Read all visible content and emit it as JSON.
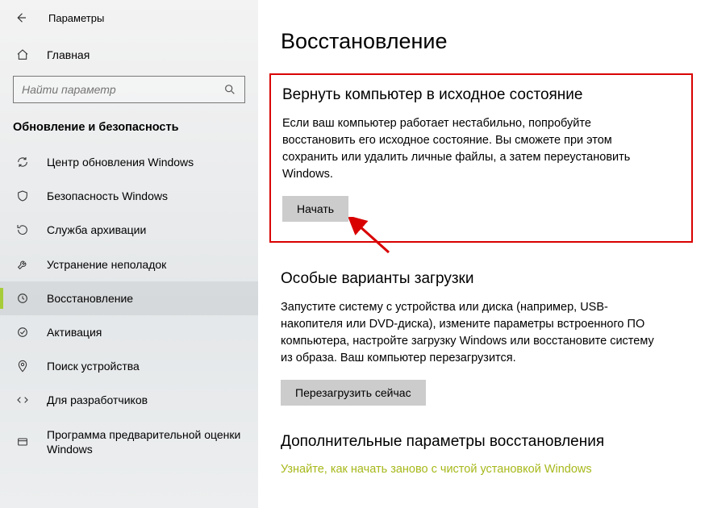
{
  "window": {
    "title": "Параметры"
  },
  "sidebar": {
    "home": "Главная",
    "search_placeholder": "Найти параметр",
    "section": "Обновление и безопасность",
    "items": [
      {
        "label": "Центр обновления Windows",
        "icon": "sync-icon"
      },
      {
        "label": "Безопасность Windows",
        "icon": "shield-icon"
      },
      {
        "label": "Служба архивации",
        "icon": "backup-icon"
      },
      {
        "label": "Устранение неполадок",
        "icon": "troubleshoot-icon"
      },
      {
        "label": "Восстановление",
        "icon": "recovery-icon",
        "active": true
      },
      {
        "label": "Активация",
        "icon": "activation-icon"
      },
      {
        "label": "Поиск устройства",
        "icon": "find-device-icon"
      },
      {
        "label": "Для разработчиков",
        "icon": "developer-icon"
      },
      {
        "label": "Программа предварительной оценки Windows",
        "icon": "insider-icon"
      }
    ]
  },
  "page": {
    "title": "Восстановление",
    "reset": {
      "heading": "Вернуть компьютер в исходное состояние",
      "body": "Если ваш компьютер работает нестабильно, попробуйте восстановить его исходное состояние. Вы сможете при этом сохранить или удалить личные файлы, а затем переустановить Windows.",
      "button": "Начать"
    },
    "advanced": {
      "heading": "Особые варианты загрузки",
      "body": "Запустите систему с устройства или диска (например, USB-накопителя или DVD-диска), измените параметры встроенного ПО компьютера, настройте загрузку Windows или восстановите систему из образа. Ваш компьютер перезагрузится.",
      "button": "Перезагрузить сейчас"
    },
    "more": {
      "heading": "Дополнительные параметры восстановления",
      "link": "Узнайте, как начать заново с чистой установкой Windows"
    }
  }
}
